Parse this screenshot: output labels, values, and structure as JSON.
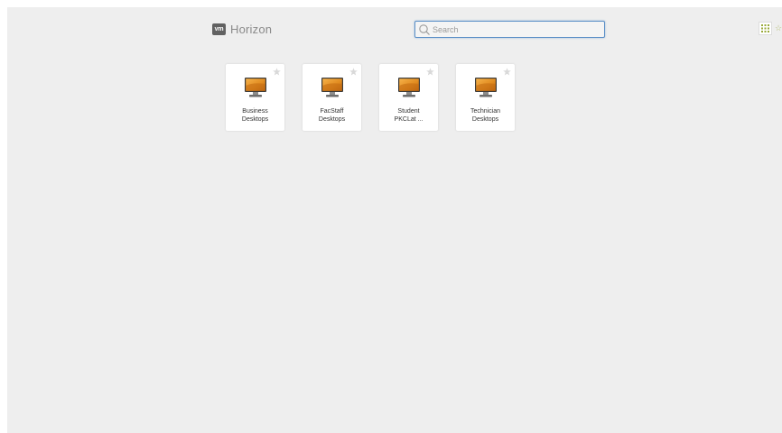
{
  "header": {
    "logo_text": "vm",
    "brand": "Horizon",
    "search_placeholder": "Search",
    "search_value": "",
    "partial_right_glyph": "☆"
  },
  "tiles": [
    {
      "line1": "Business",
      "line2": "Desktops",
      "icon": "desktop-monitor-icon",
      "favorite": false
    },
    {
      "line1": "FacStaff",
      "line2": "Desktops",
      "icon": "desktop-monitor-icon",
      "favorite": false
    },
    {
      "line1": "Student",
      "line2": "PKCLat ...",
      "icon": "desktop-monitor-icon",
      "favorite": false
    },
    {
      "line1": "Technician",
      "line2": "Desktops",
      "icon": "desktop-monitor-icon",
      "favorite": false
    }
  ],
  "colors": {
    "background": "#eeeeee",
    "search_border": "#5b8fc7",
    "grid_icon": "#9aaa3a",
    "monitor_screen": "#e08a1e"
  }
}
